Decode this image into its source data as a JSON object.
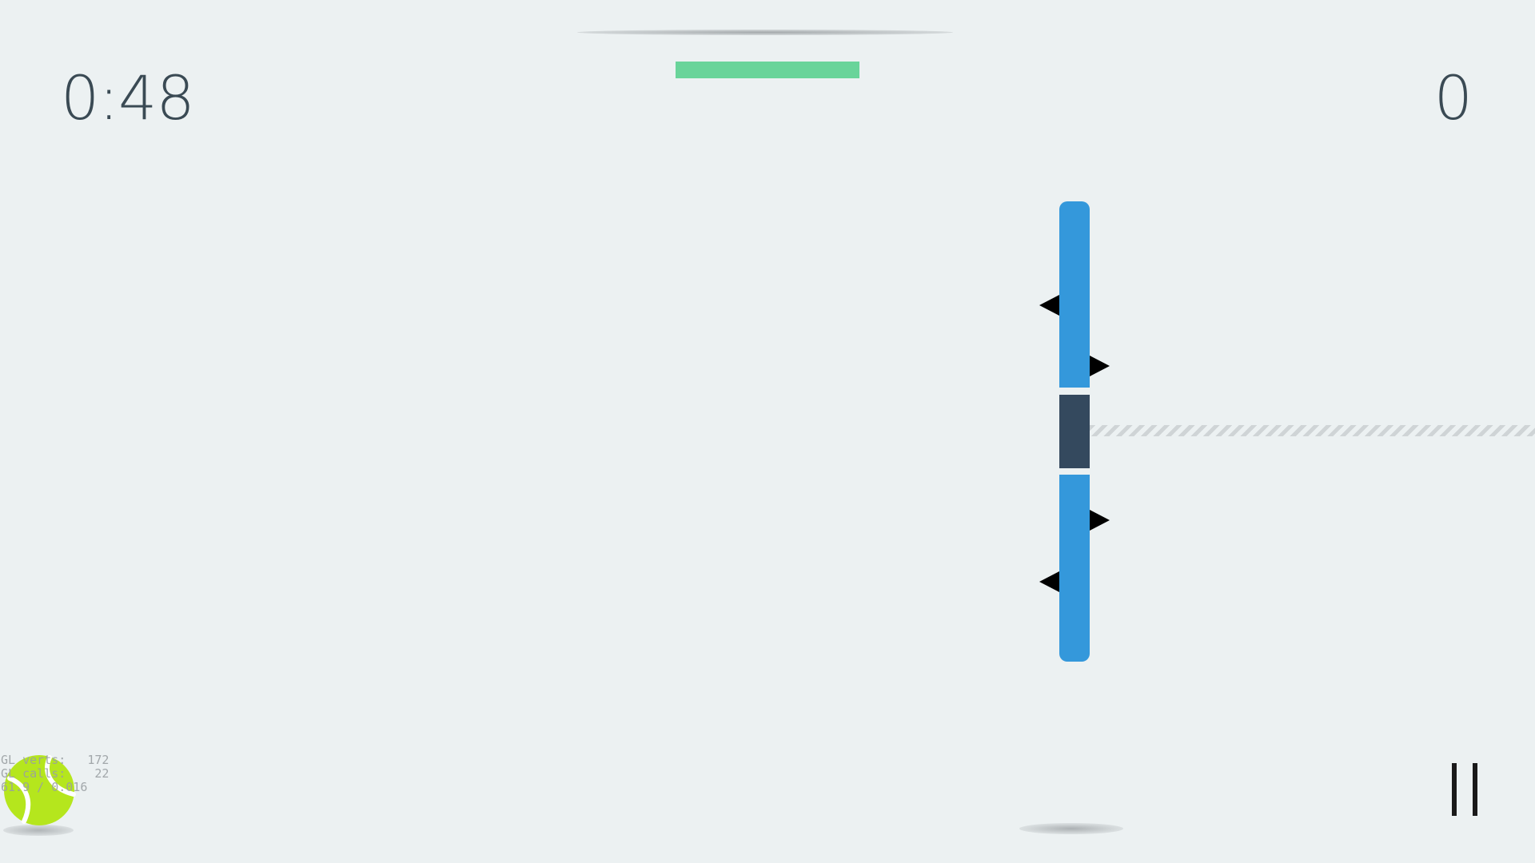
{
  "hud": {
    "timer": "0:48",
    "score": "0",
    "progress_fraction": 1.0,
    "progress_color": "#69d49a"
  },
  "debug": {
    "line1": "GL verts:   172",
    "line2": "GL calls:    22",
    "line3": "61.9 / 0.016"
  },
  "controls": {
    "pause_icon": "pause-icon"
  },
  "colors": {
    "background": "#ecf1f2",
    "paddle": "#3498db",
    "paddle_core": "#34495e",
    "ball": "#b5e61d"
  }
}
